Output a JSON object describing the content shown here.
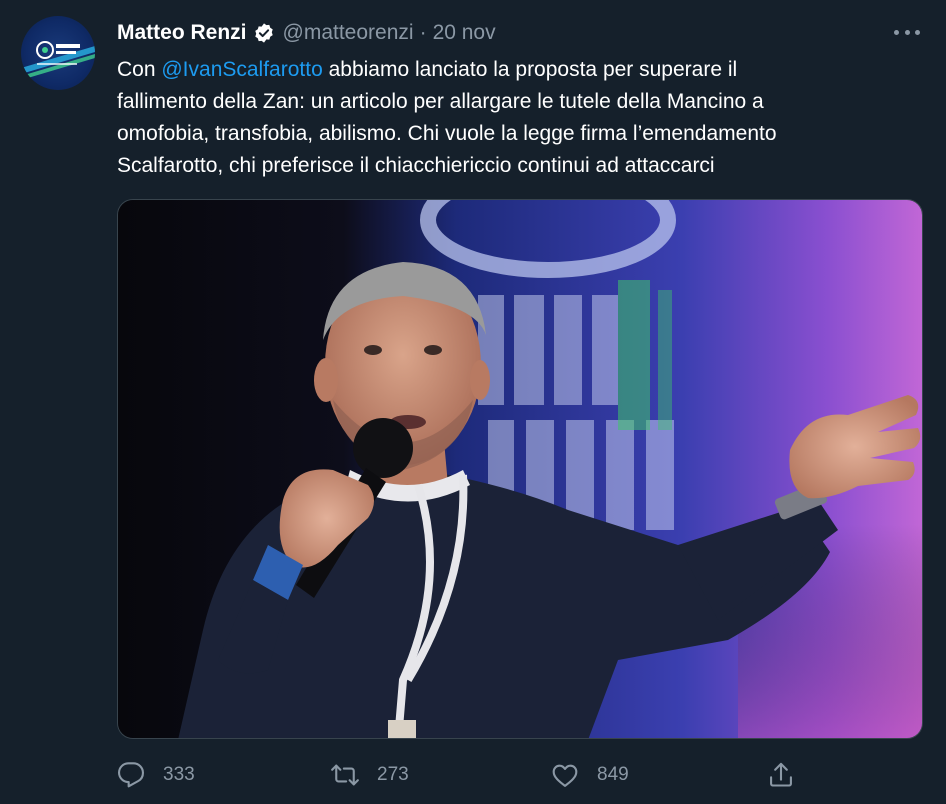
{
  "author": {
    "name": "Matteo Renzi",
    "handle": "@matteorenzi",
    "separator": "·",
    "date": "20 nov"
  },
  "tweet": {
    "line1_prefix": "Con ",
    "mention": "@IvanScalfarotto",
    "line1_suffix": " abbiamo lanciato la proposta per superare il",
    "line2": "fallimento della Zan: un articolo per allargare le tutele della Mancino a",
    "line3": "omofobia, transfobia, abilismo. Chi vuole la legge firma l’emendamento",
    "line4": "Scalfarotto, chi preferisce il chiacchiericcio continui ad attaccarci"
  },
  "stats": {
    "replies": "333",
    "retweets": "273",
    "likes": "849"
  },
  "icons": {
    "reply": "reply-icon",
    "retweet": "retweet-icon",
    "like": "heart-icon",
    "share": "share-icon",
    "more": "more-icon",
    "verified": "verified-badge-icon"
  },
  "colors": {
    "background": "#15202b",
    "text": "#ffffff",
    "muted": "#8b98a5",
    "link": "#1d9bf0"
  }
}
